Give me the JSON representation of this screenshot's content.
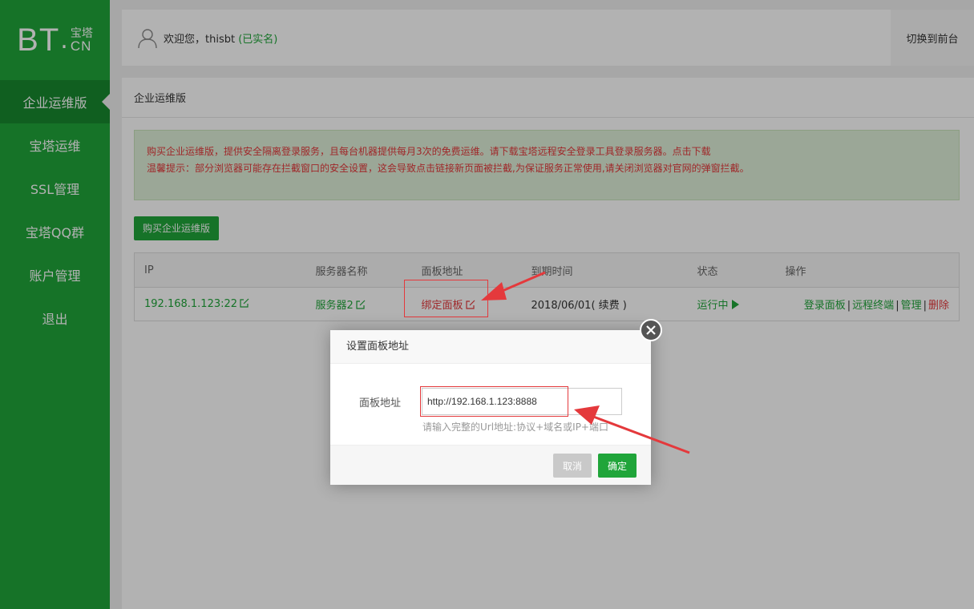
{
  "sidebar": {
    "logo": {
      "bt": "BT",
      "dot": ".",
      "cn_top": "宝塔",
      "cn_bottom": "CN"
    },
    "items": [
      {
        "label": "企业运维版",
        "active": true
      },
      {
        "label": "宝塔运维"
      },
      {
        "label": "SSL管理"
      },
      {
        "label": "宝塔QQ群"
      },
      {
        "label": "账户管理"
      },
      {
        "label": "退出"
      }
    ]
  },
  "header": {
    "welcome": "欢迎您，thisbt",
    "realname": "(已实名)",
    "switch_label": "切换到前台"
  },
  "main": {
    "title": "企业运维版",
    "notice_line1": "购买企业运维版，提供安全隔离登录服务，且每台机器提供每月3次的免费运维。请下载宝塔远程安全登录工具登录服务器。",
    "notice_link": "点击下载",
    "notice_line2": "温馨提示：部分浏览器可能存在拦截窗口的安全设置，这会导致点击链接新页面被拦截,为保证服务正常使用,请关闭浏览器对官网的弹窗拦截。",
    "buy_button": "购买企业运维版",
    "table": {
      "headers": [
        "IP",
        "服务器名称",
        "面板地址",
        "到期时间",
        "状态",
        "操作"
      ],
      "rows": [
        {
          "ip": "192.168.1.123:22",
          "name": "服务器2",
          "panel": "绑定面板",
          "expire": "2018/06/01",
          "renew": "( 续费 )",
          "status": "运行中",
          "ops": [
            "登录面板",
            "远程终端",
            "管理",
            "删除"
          ]
        }
      ]
    }
  },
  "modal": {
    "title": "设置面板地址",
    "label": "面板地址",
    "value": "http://192.168.1.123:8888",
    "hint": "请输入完整的Url地址:协议+域名或IP+端口",
    "cancel": "取消",
    "ok": "确定"
  },
  "colors": {
    "brand_green": "#20a53a",
    "alert_red": "#e4393c"
  }
}
